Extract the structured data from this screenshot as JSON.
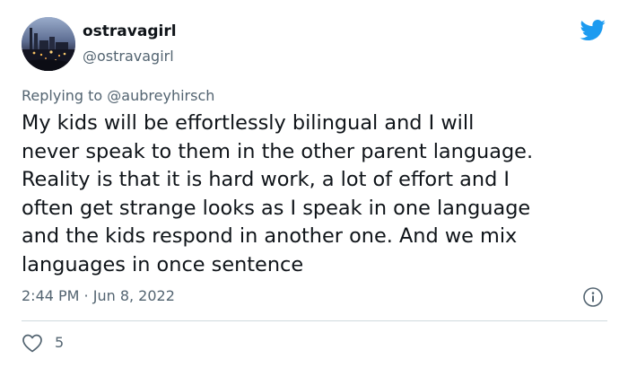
{
  "author": {
    "display_name": "ostravagirl",
    "handle": "@ostravagirl",
    "avatar_icon": "industrial-night-skyline-photo"
  },
  "brand": {
    "icon": "twitter-bird-icon",
    "color": "#1d9bf0"
  },
  "reply": {
    "prefix": "Replying to",
    "mention": "@aubreyhirsch"
  },
  "tweet": {
    "text": "My kids will be effortlessly bilingual and I will\nnever speak to them in the other parent language.\nReality is that it is hard work, a lot of effort and I\noften get strange looks as I speak in one language\nand the kids respond in another one. And we mix\nlanguages in once sentence",
    "timestamp": "2:44 PM · Jun 8, 2022"
  },
  "actions": {
    "like_icon": "heart-outline-icon",
    "like_count": "5",
    "info_icon": "info-icon"
  },
  "colors": {
    "text_primary": "#0f1419",
    "text_secondary": "#536471",
    "divider": "#cfd9de",
    "like_icon": "#536471"
  }
}
